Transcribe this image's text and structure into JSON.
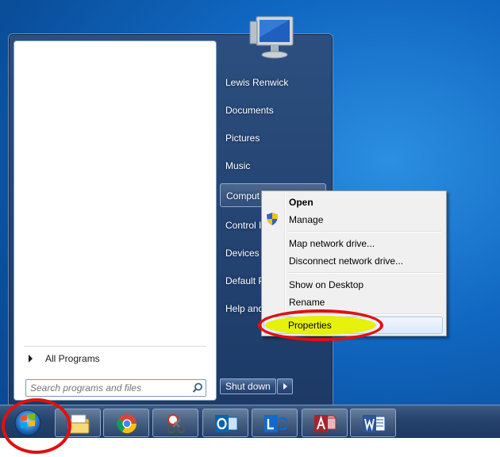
{
  "start_menu": {
    "all_programs": "All Programs",
    "search_placeholder": "Search programs and files",
    "right_items": [
      {
        "label": "Lewis Renwick"
      },
      {
        "label": "Documents"
      },
      {
        "label": "Pictures"
      },
      {
        "label": "Music"
      },
      {
        "label": "Comput"
      },
      {
        "label": "Control I"
      },
      {
        "label": "Devices a"
      },
      {
        "label": "Default P"
      },
      {
        "label": "Help and"
      }
    ],
    "shutdown_label": "Shut down"
  },
  "context_menu": {
    "items": [
      {
        "label": "Open"
      },
      {
        "label": "Manage"
      },
      {
        "label": "Map network drive..."
      },
      {
        "label": "Disconnect network drive..."
      },
      {
        "label": "Show on Desktop"
      },
      {
        "label": "Rename"
      },
      {
        "label": "Properties"
      }
    ]
  },
  "taskbar": {
    "buttons": [
      {
        "icon": "file-explorer-icon"
      },
      {
        "icon": "chrome-icon"
      },
      {
        "icon": "snipping-tool-icon"
      },
      {
        "icon": "outlook-icon"
      },
      {
        "icon": "lync-icon"
      },
      {
        "icon": "access-icon"
      },
      {
        "icon": "word-icon"
      }
    ]
  },
  "colors": {
    "annotation_red": "#e01010",
    "highlight_yellow": "#e6f000",
    "taskbar": "#24426b"
  }
}
